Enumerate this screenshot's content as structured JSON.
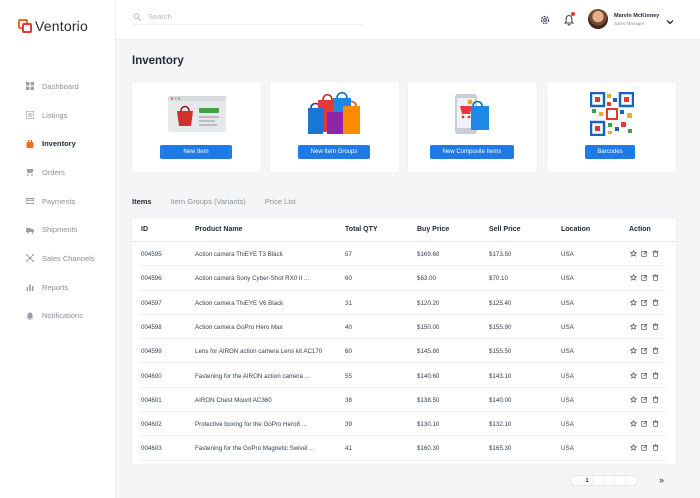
{
  "app": {
    "logo_text": "Ventorio"
  },
  "sidebar": {
    "items": [
      {
        "label": "Dashboard",
        "icon": "dashboard-icon"
      },
      {
        "label": "Listings",
        "icon": "listings-icon"
      },
      {
        "label": "Inventory",
        "icon": "inventory-icon",
        "active": true
      },
      {
        "label": "Orders",
        "icon": "orders-icon"
      },
      {
        "label": "Payments",
        "icon": "payments-icon"
      },
      {
        "label": "Shipments",
        "icon": "shipments-icon"
      },
      {
        "label": "Sales Channels",
        "icon": "sales-channels-icon"
      },
      {
        "label": "Reports",
        "icon": "reports-icon"
      },
      {
        "label": "Notifications",
        "icon": "notifications-icon"
      }
    ]
  },
  "header": {
    "search_placeholder": "Search",
    "user": {
      "name": "Marvin McKinney",
      "role": "Sales Manager"
    }
  },
  "page": {
    "title": "Inventory"
  },
  "cards": [
    {
      "button": "New Item",
      "icon": "shop-window-icon"
    },
    {
      "button": "New Item Groups",
      "icon": "shopping-bags-icon"
    },
    {
      "button": "New Composite Items",
      "icon": "mobile-shopping-icon"
    },
    {
      "button": "Barcodes",
      "icon": "qr-code-icon"
    }
  ],
  "tabs": [
    {
      "label": "Items",
      "active": true
    },
    {
      "label": "Item Groups (Variants)"
    },
    {
      "label": "Price List"
    }
  ],
  "table": {
    "columns": [
      "ID",
      "Product Name",
      "Total QTY",
      "Buy Price",
      "Sell Price",
      "Location",
      "Action"
    ],
    "rows": [
      [
        "004595",
        "Action camera ThiEYE T3 Black",
        "57",
        "$169.60",
        "$173.50",
        "USA"
      ],
      [
        "004596",
        "Action camera Sony Cyber-Shot  RX0 II ...",
        "60",
        "$63.00",
        "$70.10",
        "USA"
      ],
      [
        "004597",
        "Action camera ThiEYE V6 Black",
        "31",
        "$120.20",
        "$125.40",
        "USA"
      ],
      [
        "004598",
        "Action camera GoPro Hero Max",
        "40",
        "$150.00",
        "$155.90",
        "USA"
      ],
      [
        "004599",
        "Lens for AIRON action camera Lens kit AC170",
        "60",
        "$145.80",
        "$155.50",
        "USA"
      ],
      [
        "004600",
        "Fastening for the AIRON action camera ...",
        "55",
        "$140.60",
        "$143.10",
        "USA"
      ],
      [
        "004601",
        "AIRON Chest Mount AC360",
        "38",
        "$138.50",
        "$140.00",
        "USA"
      ],
      [
        "004602",
        "Protective boxing for the GoPro Hero8 ...",
        "39",
        "$130.10",
        "$132.10",
        "USA"
      ],
      [
        "004603",
        "Fastening for the GoPro Magnetic Swivel ...",
        "41",
        "$160.30",
        "$165.30",
        "USA"
      ]
    ]
  },
  "pagination": {
    "pages": [
      "",
      "1",
      "",
      "",
      "",
      ""
    ],
    "current": "1",
    "next_label": "»"
  },
  "colors": {
    "accent": "#1e7ae6",
    "brand": "#f26a21",
    "alert": "#e53935"
  }
}
